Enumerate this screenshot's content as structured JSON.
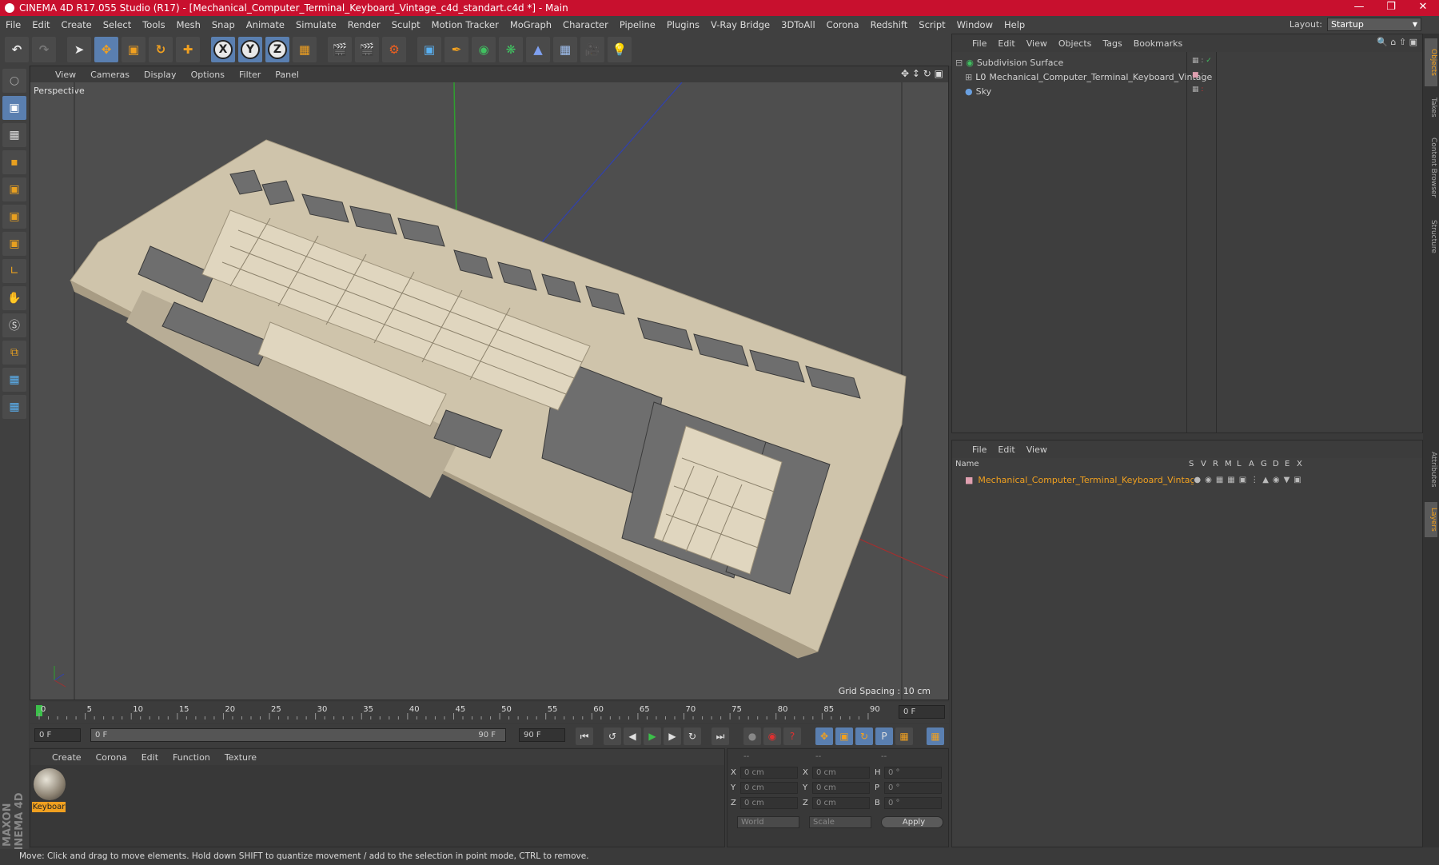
{
  "window": {
    "title": "CINEMA 4D R17.055 Studio (R17) - [Mechanical_Computer_Terminal_Keyboard_Vintage_c4d_standart.c4d *] - Main"
  },
  "menubar": {
    "items": [
      "File",
      "Edit",
      "Create",
      "Select",
      "Tools",
      "Mesh",
      "Snap",
      "Animate",
      "Simulate",
      "Render",
      "Sculpt",
      "Motion Tracker",
      "MoGraph",
      "Character",
      "Pipeline",
      "Plugins",
      "V-Ray Bridge",
      "3DToAll",
      "Corona",
      "Redshift",
      "Script",
      "Window",
      "Help"
    ],
    "layout_label": "Layout:",
    "layout_value": "Startup"
  },
  "viewport": {
    "menu": [
      "View",
      "Cameras",
      "Display",
      "Options",
      "Filter",
      "Panel"
    ],
    "label": "Perspective",
    "grid_spacing": "Grid Spacing : 10 cm"
  },
  "timeline": {
    "ticks": [
      "0",
      "5",
      "10",
      "15",
      "20",
      "25",
      "30",
      "35",
      "40",
      "45",
      "50",
      "55",
      "60",
      "65",
      "70",
      "75",
      "80",
      "85",
      "90"
    ],
    "current_frame": "0 F"
  },
  "playbar": {
    "start": "0 F",
    "range_start": "0 F",
    "range_end": "90 F",
    "end": "90 F"
  },
  "materials": {
    "menu": [
      "Create",
      "Corona",
      "Edit",
      "Function",
      "Texture"
    ],
    "items": [
      "Keyboar"
    ]
  },
  "coords": {
    "headers": [
      "--",
      "--",
      "--"
    ],
    "rows": [
      {
        "a": "X",
        "av": "0 cm",
        "b": "X",
        "bv": "0 cm",
        "c": "H",
        "cv": "0 °"
      },
      {
        "a": "Y",
        "av": "0 cm",
        "b": "Y",
        "bv": "0 cm",
        "c": "P",
        "cv": "0 °"
      },
      {
        "a": "Z",
        "av": "0 cm",
        "b": "Z",
        "bv": "0 cm",
        "c": "B",
        "cv": "0 °"
      }
    ],
    "world": "World",
    "scale": "Scale",
    "apply": "Apply"
  },
  "objects": {
    "menu": [
      "File",
      "Edit",
      "View",
      "Objects",
      "Tags",
      "Bookmarks"
    ],
    "items": [
      "Subdivision Surface",
      "Mechanical_Computer_Terminal_Keyboard_Vintage",
      "Sky"
    ]
  },
  "layers": {
    "menu": [
      "File",
      "Edit",
      "View"
    ],
    "name_header": "Name",
    "cols": [
      "S",
      "V",
      "R",
      "M",
      "L",
      "A",
      "G",
      "D",
      "E",
      "X"
    ],
    "items": [
      "Mechanical_Computer_Terminal_Keyboard_Vintage"
    ]
  },
  "right_tabs": [
    "Objects",
    "Takes",
    "Content Browser",
    "Structure",
    "Attributes",
    "Layers"
  ],
  "status": "Move: Click and drag to move elements. Hold down SHIFT to quantize movement / add to the selection in point mode, CTRL to remove.",
  "brand": "MAXON CINEMA 4D",
  "colors": {
    "title_red": "#c8102e",
    "accent_orange": "#f0a020",
    "selected_blue": "#5a7fb0"
  }
}
